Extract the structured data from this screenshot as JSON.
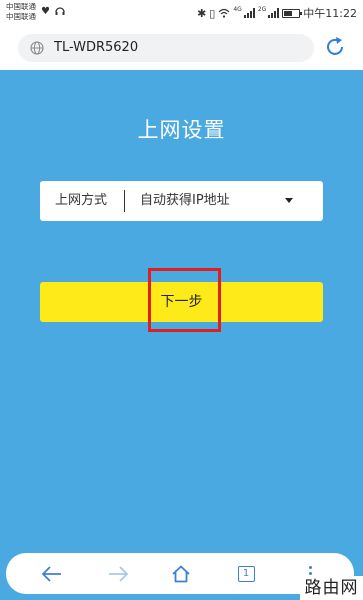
{
  "status_bar": {
    "carrier_1": "中国联通",
    "carrier_2": "中国联通",
    "signal_1_label": "4G",
    "signal_2_label": "2G",
    "time": "中午11:22",
    "icons": [
      "heart-icon",
      "headset-icon",
      "bluetooth-icon",
      "vibrate-icon",
      "wifi-icon",
      "signal-icon",
      "battery-icon"
    ]
  },
  "browser": {
    "url": "TL-WDR5620",
    "icons": [
      "globe-icon",
      "reload-icon"
    ]
  },
  "page": {
    "title": "上网设置",
    "connection_type_label": "上网方式",
    "connection_type_value": "自动获得IP地址",
    "next_button": "下一步"
  },
  "bottom_nav": {
    "tab_count": "1",
    "icons": [
      "back-arrow-icon",
      "forward-arrow-icon",
      "home-icon",
      "tabs-icon",
      "more-menu-icon"
    ]
  },
  "watermark": "路由网",
  "colors": {
    "background": "#4aa9e0",
    "button": "#ffea19",
    "highlight": "#e0201f",
    "nav_accent": "#3f7fd6"
  }
}
